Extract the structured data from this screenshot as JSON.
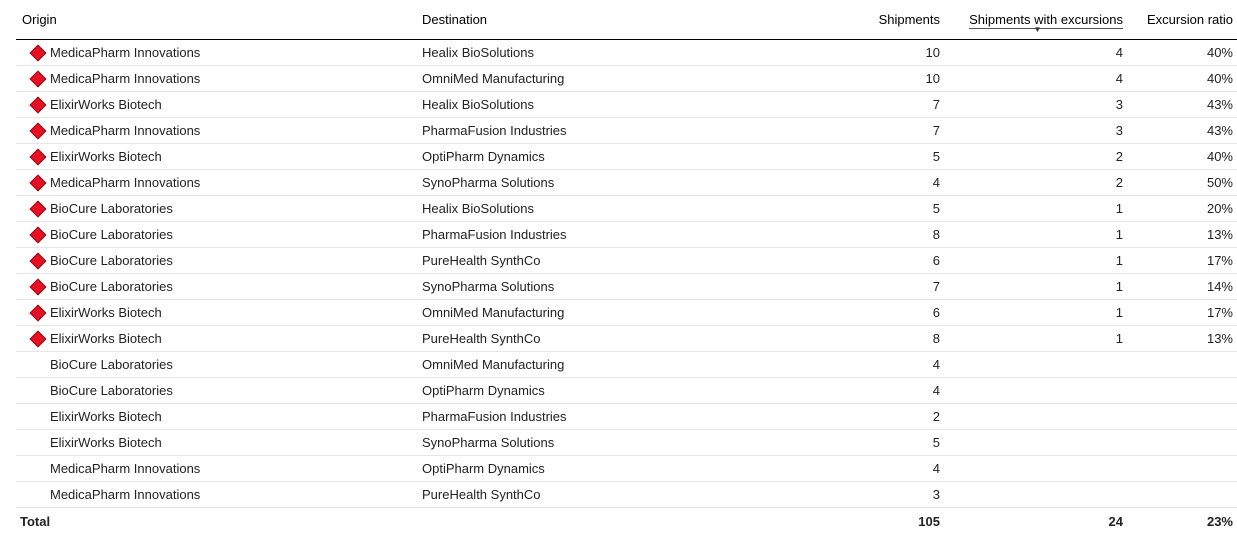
{
  "columns": {
    "origin": "Origin",
    "destination": "Destination",
    "shipments": "Shipments",
    "shipments_with_excursions": "Shipments with excursions",
    "excursion_ratio": "Excursion ratio"
  },
  "sort_column": "shipments_with_excursions",
  "sort_direction": "desc",
  "rows": [
    {
      "icon": true,
      "origin": "MedicaPharm Innovations",
      "destination": "Healix BioSolutions",
      "shipments": "10",
      "excursions": "4",
      "ratio": "40%"
    },
    {
      "icon": true,
      "origin": "MedicaPharm Innovations",
      "destination": "OmniMed Manufacturing",
      "shipments": "10",
      "excursions": "4",
      "ratio": "40%"
    },
    {
      "icon": true,
      "origin": "ElixirWorks Biotech",
      "destination": "Healix BioSolutions",
      "shipments": "7",
      "excursions": "3",
      "ratio": "43%"
    },
    {
      "icon": true,
      "origin": "MedicaPharm Innovations",
      "destination": "PharmaFusion Industries",
      "shipments": "7",
      "excursions": "3",
      "ratio": "43%"
    },
    {
      "icon": true,
      "origin": "ElixirWorks Biotech",
      "destination": "OptiPharm Dynamics",
      "shipments": "5",
      "excursions": "2",
      "ratio": "40%"
    },
    {
      "icon": true,
      "origin": "MedicaPharm Innovations",
      "destination": "SynoPharma Solutions",
      "shipments": "4",
      "excursions": "2",
      "ratio": "50%"
    },
    {
      "icon": true,
      "origin": "BioCure Laboratories",
      "destination": "Healix BioSolutions",
      "shipments": "5",
      "excursions": "1",
      "ratio": "20%"
    },
    {
      "icon": true,
      "origin": "BioCure Laboratories",
      "destination": "PharmaFusion Industries",
      "shipments": "8",
      "excursions": "1",
      "ratio": "13%"
    },
    {
      "icon": true,
      "origin": "BioCure Laboratories",
      "destination": "PureHealth SynthCo",
      "shipments": "6",
      "excursions": "1",
      "ratio": "17%"
    },
    {
      "icon": true,
      "origin": "BioCure Laboratories",
      "destination": "SynoPharma Solutions",
      "shipments": "7",
      "excursions": "1",
      "ratio": "14%"
    },
    {
      "icon": true,
      "origin": "ElixirWorks Biotech",
      "destination": "OmniMed Manufacturing",
      "shipments": "6",
      "excursions": "1",
      "ratio": "17%"
    },
    {
      "icon": true,
      "origin": "ElixirWorks Biotech",
      "destination": "PureHealth SynthCo",
      "shipments": "8",
      "excursions": "1",
      "ratio": "13%"
    },
    {
      "icon": false,
      "origin": "BioCure Laboratories",
      "destination": "OmniMed Manufacturing",
      "shipments": "4",
      "excursions": "",
      "ratio": ""
    },
    {
      "icon": false,
      "origin": "BioCure Laboratories",
      "destination": "OptiPharm Dynamics",
      "shipments": "4",
      "excursions": "",
      "ratio": ""
    },
    {
      "icon": false,
      "origin": "ElixirWorks Biotech",
      "destination": "PharmaFusion Industries",
      "shipments": "2",
      "excursions": "",
      "ratio": ""
    },
    {
      "icon": false,
      "origin": "ElixirWorks Biotech",
      "destination": "SynoPharma Solutions",
      "shipments": "5",
      "excursions": "",
      "ratio": ""
    },
    {
      "icon": false,
      "origin": "MedicaPharm Innovations",
      "destination": "OptiPharm Dynamics",
      "shipments": "4",
      "excursions": "",
      "ratio": ""
    },
    {
      "icon": false,
      "origin": "MedicaPharm Innovations",
      "destination": "PureHealth SynthCo",
      "shipments": "3",
      "excursions": "",
      "ratio": ""
    }
  ],
  "totals": {
    "label": "Total",
    "shipments": "105",
    "excursions": "24",
    "ratio": "23%"
  }
}
